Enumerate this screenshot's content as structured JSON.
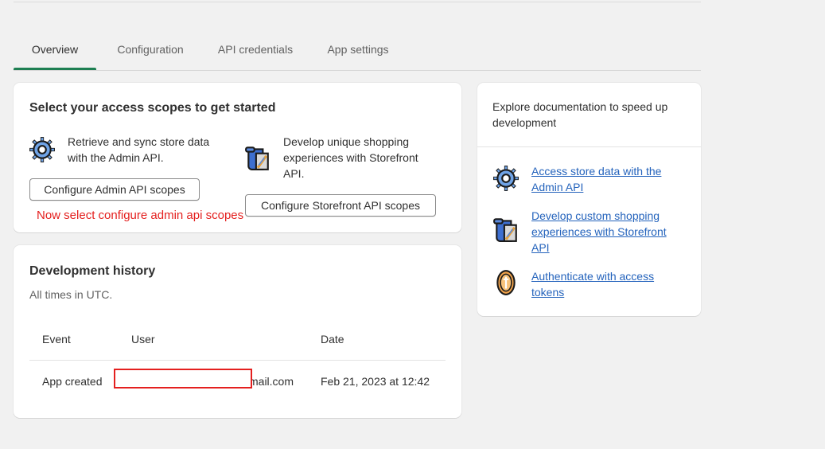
{
  "tabs": [
    {
      "label": "Overview",
      "active": true
    },
    {
      "label": "Configuration",
      "active": false
    },
    {
      "label": "API credentials",
      "active": false
    },
    {
      "label": "App settings",
      "active": false
    }
  ],
  "scopes_card": {
    "title": "Select your access scopes to get started",
    "admin": {
      "description": "Retrieve and sync store data with the Admin API.",
      "button_label": "Configure Admin API scopes",
      "icon": "gear-icon"
    },
    "storefront": {
      "description": "Develop unique shopping experiences with Storefront API.",
      "button_label": "Configure Storefront API scopes",
      "icon": "storefront-icon"
    },
    "annotation": "Now select configure admin api scopes"
  },
  "history_card": {
    "title": "Development history",
    "subtitle": "All times in UTC.",
    "columns": [
      "Event",
      "User",
      "Date"
    ],
    "rows": [
      {
        "event": "App created",
        "user_visible_suffix": "mail.com",
        "date": "Feb 21, 2023 at 12:42"
      }
    ]
  },
  "docs_card": {
    "title": "Explore documentation to speed up development",
    "links": [
      {
        "label": "Access store data with the Admin API",
        "icon": "gear-icon"
      },
      {
        "label": "Develop custom shopping experiences with Storefront API",
        "icon": "storefront-icon"
      },
      {
        "label": "Authenticate with access tokens",
        "icon": "coin-token-icon"
      }
    ]
  },
  "colors": {
    "accent_green": "#1e7f52",
    "link_blue": "#2463bc",
    "annotation_red": "#e4201f",
    "background": "#f1f1f1"
  }
}
